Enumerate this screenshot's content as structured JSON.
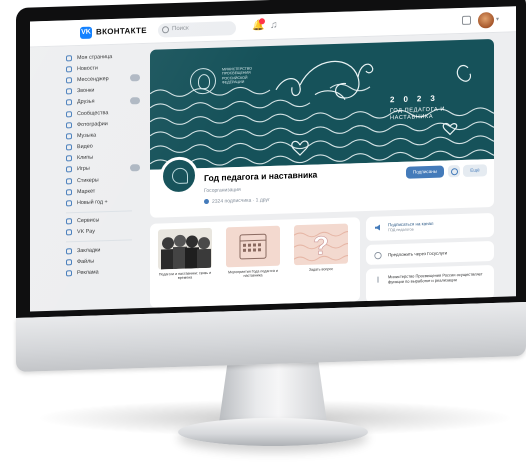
{
  "header": {
    "brand": "ВКОНТАКТЕ",
    "logo_letters": "VK",
    "search_placeholder": "Поиск",
    "icons": [
      "bell-icon",
      "music-icon",
      "grid-icon"
    ],
    "notification_color": "#ff3347",
    "accent": "#0077ff"
  },
  "menu": {
    "items": [
      {
        "label": "Моя страница"
      },
      {
        "label": "Новости"
      },
      {
        "label": "Мессенджер",
        "badge": true
      },
      {
        "label": "Звонки"
      },
      {
        "label": "Друзья",
        "badge": true
      },
      {
        "label": "Сообщества"
      },
      {
        "label": "Фотографии"
      },
      {
        "label": "Музыка"
      },
      {
        "label": "Видео"
      },
      {
        "label": "Клипы"
      },
      {
        "label": "Игры",
        "badge": true
      },
      {
        "label": "Стикеры"
      },
      {
        "label": "Маркет"
      },
      {
        "label": "Новый год +"
      }
    ],
    "items2": [
      {
        "label": "Сервисы"
      },
      {
        "label": "VK Pay"
      }
    ],
    "items3": [
      {
        "label": "Закладки"
      },
      {
        "label": "Файлы"
      },
      {
        "label": "Реклама"
      }
    ]
  },
  "cover": {
    "ministry": "МИНИСТЕРСТВО ПРОСВЕЩЕНИЯ РОССИЙСКОЙ ФЕДЕРАЦИИ",
    "year": "2023",
    "title": "ГОД ПЕДАГОГА И НАСТАВНИКА",
    "background": "#16525a"
  },
  "profile": {
    "name": "Год педагога и наставника",
    "status": "Госорганизация",
    "subscribers": "2324 подписчика · 1 друг",
    "subscribed_label": "Подписаны",
    "more_label": "Ещё"
  },
  "links": [
    {
      "title": "Педагоги и наставники: связь и времена"
    },
    {
      "title": "Мероприятия Года педагога и наставника"
    },
    {
      "title": "Задать вопрос"
    }
  ],
  "right": {
    "notify_title": "Подписаться на канал",
    "notify_sub": "ГОД педагогов",
    "suggest": "Предложить через Госуслуги",
    "post_text": "Министерство Просвещения России осуществляет функции по выработке и реализации"
  }
}
